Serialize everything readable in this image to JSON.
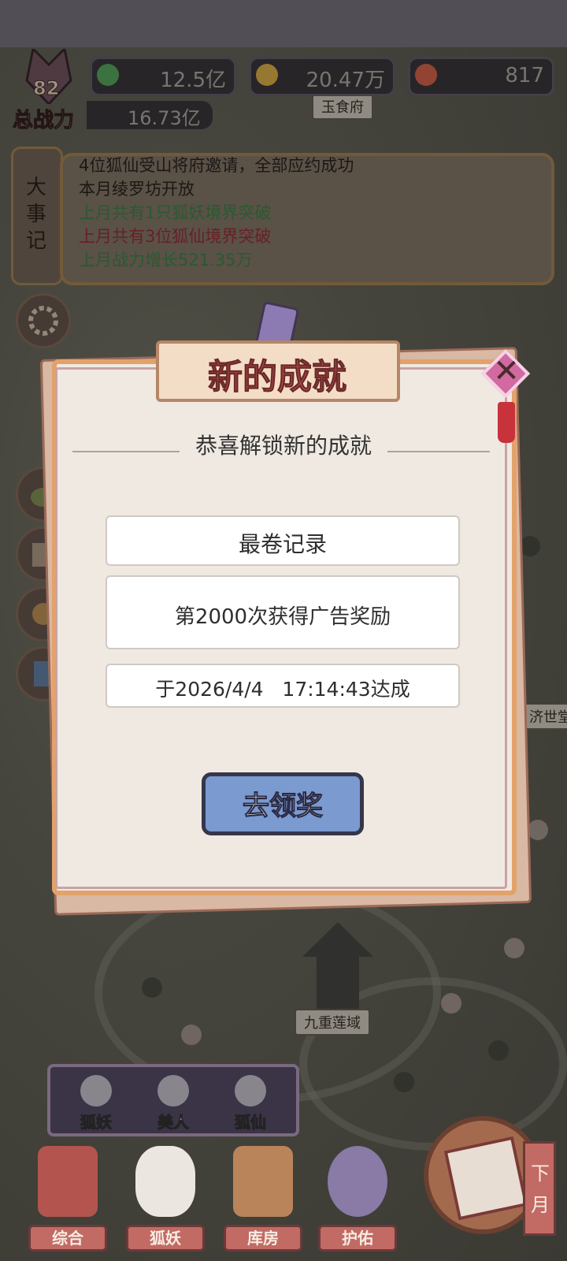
{
  "resources": [
    {
      "value": "12.5亿",
      "icon": "jade-icon",
      "color": "#5cae63"
    },
    {
      "value": "20.47万",
      "icon": "gold-ingot-icon",
      "color": "#e7b84a"
    },
    {
      "value": "817",
      "icon": "peach-icon",
      "color": "#e0694f"
    }
  ],
  "power": {
    "level": "82",
    "label": "总战力",
    "value": "16.73亿"
  },
  "events": {
    "tab_label": "大事记",
    "lines": [
      {
        "text": "4位狐仙受山将府邀请，全部应约成功",
        "color": "#2c2622"
      },
      {
        "text": "本月绫罗坊开放",
        "color": "#2c2622"
      },
      {
        "text": "上月共有1只狐妖境界突破",
        "color": "#3f8a4a"
      },
      {
        "text": "上月共有3位狐仙境界突破",
        "color": "#a0323a"
      },
      {
        "text": "上月战力增长521.35万",
        "color": "#3f8a4a"
      }
    ]
  },
  "dialog": {
    "title": "新的成就",
    "subtitle": "恭喜解锁新的成就",
    "achievement_name": "最卷记录",
    "achievement_desc": "第2000次获得广告奖励",
    "achieved_at": "于2026/4/4   17:14:43达成",
    "claim_label": "去领奖"
  },
  "map": {
    "places": [
      "九重莲域",
      "济世堂",
      "玉食府"
    ]
  },
  "filters": [
    "狐妖",
    "美人",
    "狐仙"
  ],
  "nav": [
    "综合",
    "狐妖",
    "库房",
    "护佑"
  ],
  "next_month": "下月"
}
